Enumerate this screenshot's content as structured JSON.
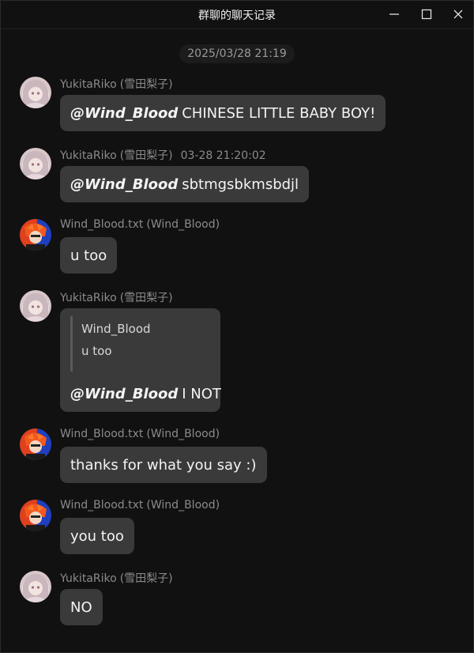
{
  "window": {
    "title": "群聊的聊天记录"
  },
  "timestamp": "2025/03/28 21:19",
  "messages": [
    {
      "sender": "YukitaRiko",
      "sender_id": "(雪田梨子)",
      "time": "",
      "mention": "@Wind_Blood",
      "text": "CHINESE LITTLE BABY BOY!"
    },
    {
      "sender": "YukitaRiko",
      "sender_id": "(雪田梨子)",
      "time": "03-28 21:20:02",
      "mention": "@Wind_Blood",
      "text": "sbtmgsbkmsbdjl"
    },
    {
      "sender": "Wind_Blood.txt",
      "sender_id": "(Wind_Blood)",
      "text": "u too"
    },
    {
      "sender": "YukitaRiko",
      "sender_id": "(雪田梨子)",
      "quote_author": "Wind_Blood",
      "quote_text": "u too",
      "mention": "@Wind_Blood",
      "text": "I NOT"
    },
    {
      "sender": "Wind_Blood.txt",
      "sender_id": "(Wind_Blood)",
      "text": "thanks for what you say :)"
    },
    {
      "sender": "Wind_Blood.txt",
      "sender_id": "(Wind_Blood)",
      "text": "you too"
    },
    {
      "sender": "YukitaRiko",
      "sender_id": "(雪田梨子)",
      "text": "NO"
    }
  ]
}
